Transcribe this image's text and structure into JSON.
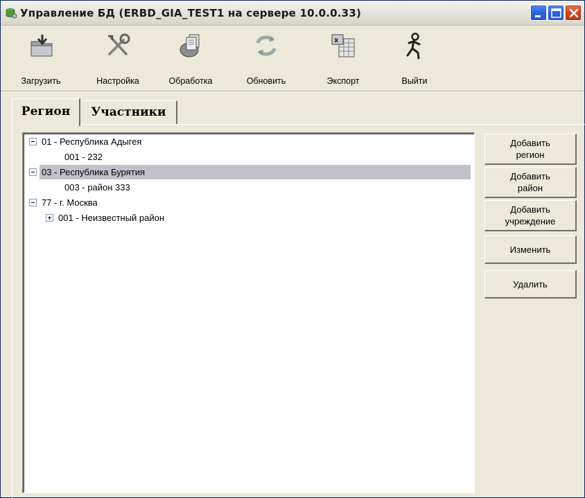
{
  "window": {
    "title": "Управление БД (ERBD_GIA_TEST1 на сервере 10.0.0.33)",
    "icon": "database-gear-icon",
    "controls": [
      "minimize-icon",
      "maximize-icon",
      "close-icon"
    ]
  },
  "toolbar": {
    "items": [
      {
        "label": "Загрузить",
        "icon": "load-folder-icon"
      },
      {
        "label": "Настройка",
        "icon": "tools-icon"
      },
      {
        "label": "Обработка",
        "icon": "process-icon"
      },
      {
        "label": "Обновить",
        "icon": "refresh-icon"
      },
      {
        "label": "Экспорт",
        "icon": "excel-export-icon"
      },
      {
        "label": "Выйти",
        "icon": "exit-runner-icon"
      }
    ]
  },
  "tabs": [
    {
      "label": "Регион",
      "active": true
    },
    {
      "label": "Участники",
      "active": false
    }
  ],
  "tree": {
    "nodes": [
      {
        "label": "01 - Республика Адыгея",
        "level": 0,
        "expander": "minus"
      },
      {
        "label": "001 - 232",
        "level": 1,
        "expander": "none"
      },
      {
        "label": "03 - Республика Бурятия",
        "level": 0,
        "expander": "minus",
        "selected": true
      },
      {
        "label": "003 - район 333",
        "level": 1,
        "expander": "none"
      },
      {
        "label": "77 - г. Москва",
        "level": 0,
        "expander": "minus"
      },
      {
        "label": "001 - Неизвестный район",
        "level": 1,
        "expander": "plus"
      }
    ]
  },
  "buttons": {
    "add_region": [
      "Добавить",
      "регион"
    ],
    "add_district": [
      "Добавить",
      "район"
    ],
    "add_institution": [
      "Добавить",
      "учреждение"
    ],
    "edit": "Изменить",
    "delete": "Удалить"
  },
  "colors": {
    "window_bg": "#ece9d8",
    "selection": "#c2c1cb",
    "close_button": "#d2461f"
  }
}
